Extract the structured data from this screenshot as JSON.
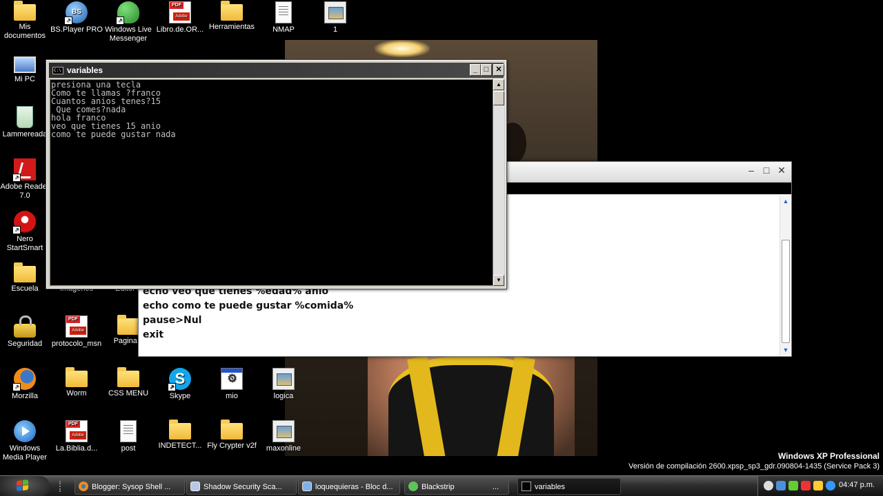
{
  "desktop": {
    "icons": [
      {
        "label": "Mis documentos",
        "icon": "my-documents-icon"
      },
      {
        "label": "BS.Player PRO",
        "icon": "bsplayer-icon"
      },
      {
        "label": "Windows Live Messenger",
        "icon": "messenger-icon"
      },
      {
        "label": "Libro.de.OR...",
        "icon": "pdf-file-icon"
      },
      {
        "label": "Herramientas",
        "icon": "folder-icon"
      },
      {
        "label": "NMAP",
        "icon": "text-file-icon"
      },
      {
        "label": "1",
        "icon": "image-file-icon"
      },
      {
        "label": "Mi PC",
        "icon": "my-computer-icon"
      },
      {
        "label": "Lammereada",
        "icon": "recycle-bin-icon"
      },
      {
        "label": "Adobe Reader 7.0",
        "icon": "adobe-reader-icon"
      },
      {
        "label": "Nero StartSmart",
        "icon": "nero-icon"
      },
      {
        "label": "Escuela",
        "icon": "folder-icon"
      },
      {
        "label": "Imagenes",
        "icon": "folder-icon"
      },
      {
        "label": "Editor h",
        "icon": "folder-icon"
      },
      {
        "label": "Seguridad",
        "icon": "lock-icon"
      },
      {
        "label": "protocolo_msn",
        "icon": "pdf-file-icon"
      },
      {
        "label": "Pagina c",
        "icon": "folder-icon"
      },
      {
        "label": "Morzilla",
        "icon": "firefox-icon"
      },
      {
        "label": "Worm",
        "icon": "folder-icon"
      },
      {
        "label": "CSS MENU",
        "icon": "folder-icon"
      },
      {
        "label": "Skype",
        "icon": "skype-icon"
      },
      {
        "label": "mio",
        "icon": "program-icon"
      },
      {
        "label": "logica",
        "icon": "image-file-icon"
      },
      {
        "label": "Windows Media Player",
        "icon": "media-player-icon"
      },
      {
        "label": "La.Biblia.d...",
        "icon": "pdf-file-icon"
      },
      {
        "label": "post",
        "icon": "text-file-icon"
      },
      {
        "label": "INDETECT...",
        "icon": "folder-icon"
      },
      {
        "label": "Fly Crypter v2f",
        "icon": "folder-icon"
      },
      {
        "label": "maxonline",
        "icon": "image-file-icon"
      }
    ]
  },
  "console": {
    "title": "variables",
    "icon_label": "C:\\",
    "output": "presiona una tecla\nComo te llamas ?franco\nCuantos anios tenes?15\n Que comes?nada\nhola franco\nveo que tienes 15 anio\ncomo te puede gustar nada",
    "buttons": {
      "minimize": "_",
      "maximize": "□",
      "close": "✕"
    },
    "scroll": {
      "up": "▲",
      "down": "▼"
    }
  },
  "editor": {
    "buttons": {
      "minimize": "–",
      "maximize": "□",
      "close": "✕"
    },
    "text": "echo veo que tienes %edad% anio\necho como te puede gustar %comida%\npause>Nul\nexit",
    "scroll": {
      "up": "▲",
      "down": "▼"
    }
  },
  "watermark": {
    "title": "Windows XP Professional",
    "build": "Versión de compilación 2600.xpsp_sp3_gdr.090804-1435 (Service Pack 3)"
  },
  "taskbar": {
    "buttons": [
      {
        "label": "Blogger: Sysop Shell ...",
        "icon": "firefox-icon",
        "active": false
      },
      {
        "label": "Shadow Security Sca...",
        "icon": "scanner-icon",
        "active": false
      },
      {
        "label": "loquequieras - Bloc d...",
        "icon": "notepad-icon",
        "active": false
      },
      {
        "label": "Blackstrip",
        "icon": "messenger-icon",
        "active": false
      },
      {
        "label": "...",
        "icon": "",
        "active": false
      },
      {
        "label": "variables",
        "icon": "console-icon",
        "active": true
      }
    ],
    "clock": "04:47 p.m."
  },
  "colors": {
    "taskbar": "#2e2e2e",
    "console_bg": "#000000",
    "console_text": "#c0c0c0",
    "console_title": "#3a3a3a"
  }
}
